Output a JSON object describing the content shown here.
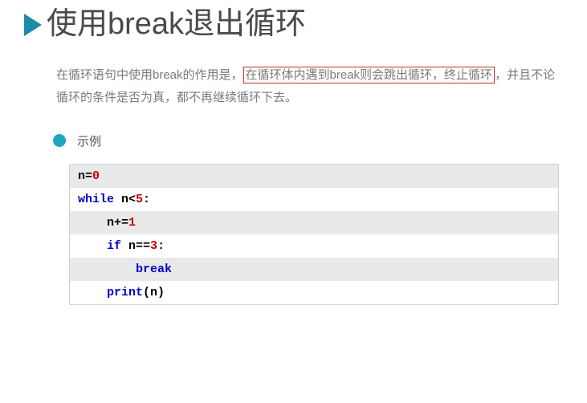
{
  "title": "使用break退出循环",
  "para": {
    "before": "在循环语句中使用break的作用是，",
    "highlight": "在循环体内遇到break则会跳出循环，终止循环",
    "after": "，并且不论循环的条件是否为真，都不再继续循环下去。"
  },
  "example_label": "示例",
  "code": [
    {
      "segments": [
        {
          "t": "n=",
          "c": "plain"
        },
        {
          "t": "0",
          "c": "num"
        }
      ]
    },
    {
      "segments": [
        {
          "t": "while",
          "c": "kw"
        },
        {
          "t": " n<",
          "c": "plain"
        },
        {
          "t": "5",
          "c": "num"
        },
        {
          "t": ":",
          "c": "plain"
        }
      ]
    },
    {
      "segments": [
        {
          "t": "    n+=",
          "c": "plain"
        },
        {
          "t": "1",
          "c": "num"
        }
      ]
    },
    {
      "segments": [
        {
          "t": "    ",
          "c": "plain"
        },
        {
          "t": "if",
          "c": "kw"
        },
        {
          "t": " n==",
          "c": "plain"
        },
        {
          "t": "3",
          "c": "num"
        },
        {
          "t": ":",
          "c": "plain"
        }
      ]
    },
    {
      "segments": [
        {
          "t": "        ",
          "c": "plain"
        },
        {
          "t": "break",
          "c": "kw"
        }
      ]
    },
    {
      "segments": [
        {
          "t": "    ",
          "c": "plain"
        },
        {
          "t": "print",
          "c": "kw"
        },
        {
          "t": "(n)",
          "c": "plain"
        }
      ]
    }
  ]
}
